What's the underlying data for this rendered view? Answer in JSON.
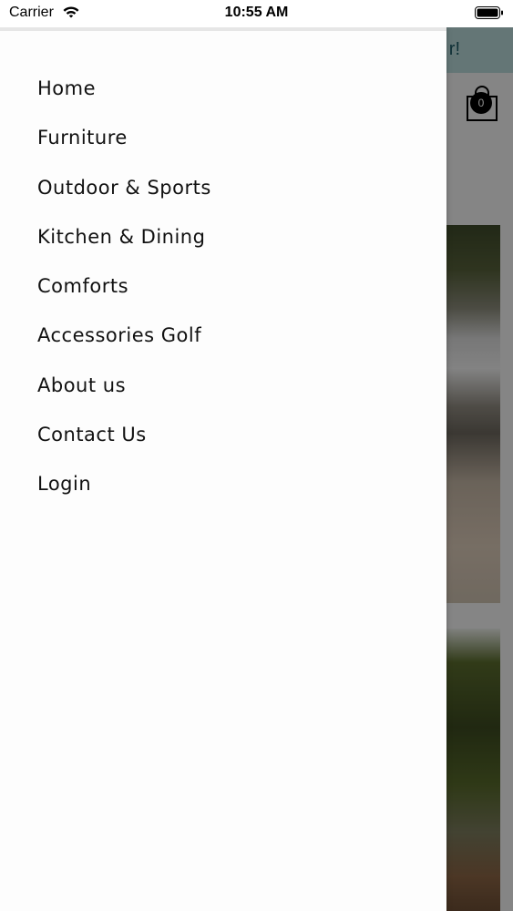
{
  "status_bar": {
    "carrier": "Carrier",
    "time": "10:55 AM",
    "wifi_icon": "wifi-icon",
    "battery_icon": "battery-icon"
  },
  "background": {
    "banner_text": "r!",
    "cart_count": "0",
    "cart_icon": "shopping-bag-icon"
  },
  "drawer": {
    "items": [
      {
        "label": "Home"
      },
      {
        "label": "Furniture"
      },
      {
        "label": "Outdoor & Sports"
      },
      {
        "label": "Kitchen & Dining"
      },
      {
        "label": "Comforts"
      },
      {
        "label": "Accessories Golf"
      },
      {
        "label": "About us"
      },
      {
        "label": "Contact Us"
      },
      {
        "label": "Login"
      }
    ]
  },
  "colors": {
    "banner": "#b7d8d8",
    "banner_text": "#1d5964",
    "drawer_bg": "#fdfdfd",
    "overlay": "rgba(0,0,0,0.45)"
  }
}
